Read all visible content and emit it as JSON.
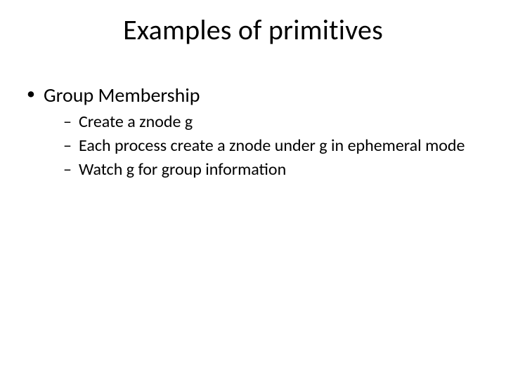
{
  "title": "Examples of primitives",
  "bullets": {
    "l1_0": "Group Membership",
    "l2_0": "Create a znode g",
    "l2_1": "Each process create a znode under g in ephemeral mode",
    "l2_2": "Watch g for group information"
  }
}
